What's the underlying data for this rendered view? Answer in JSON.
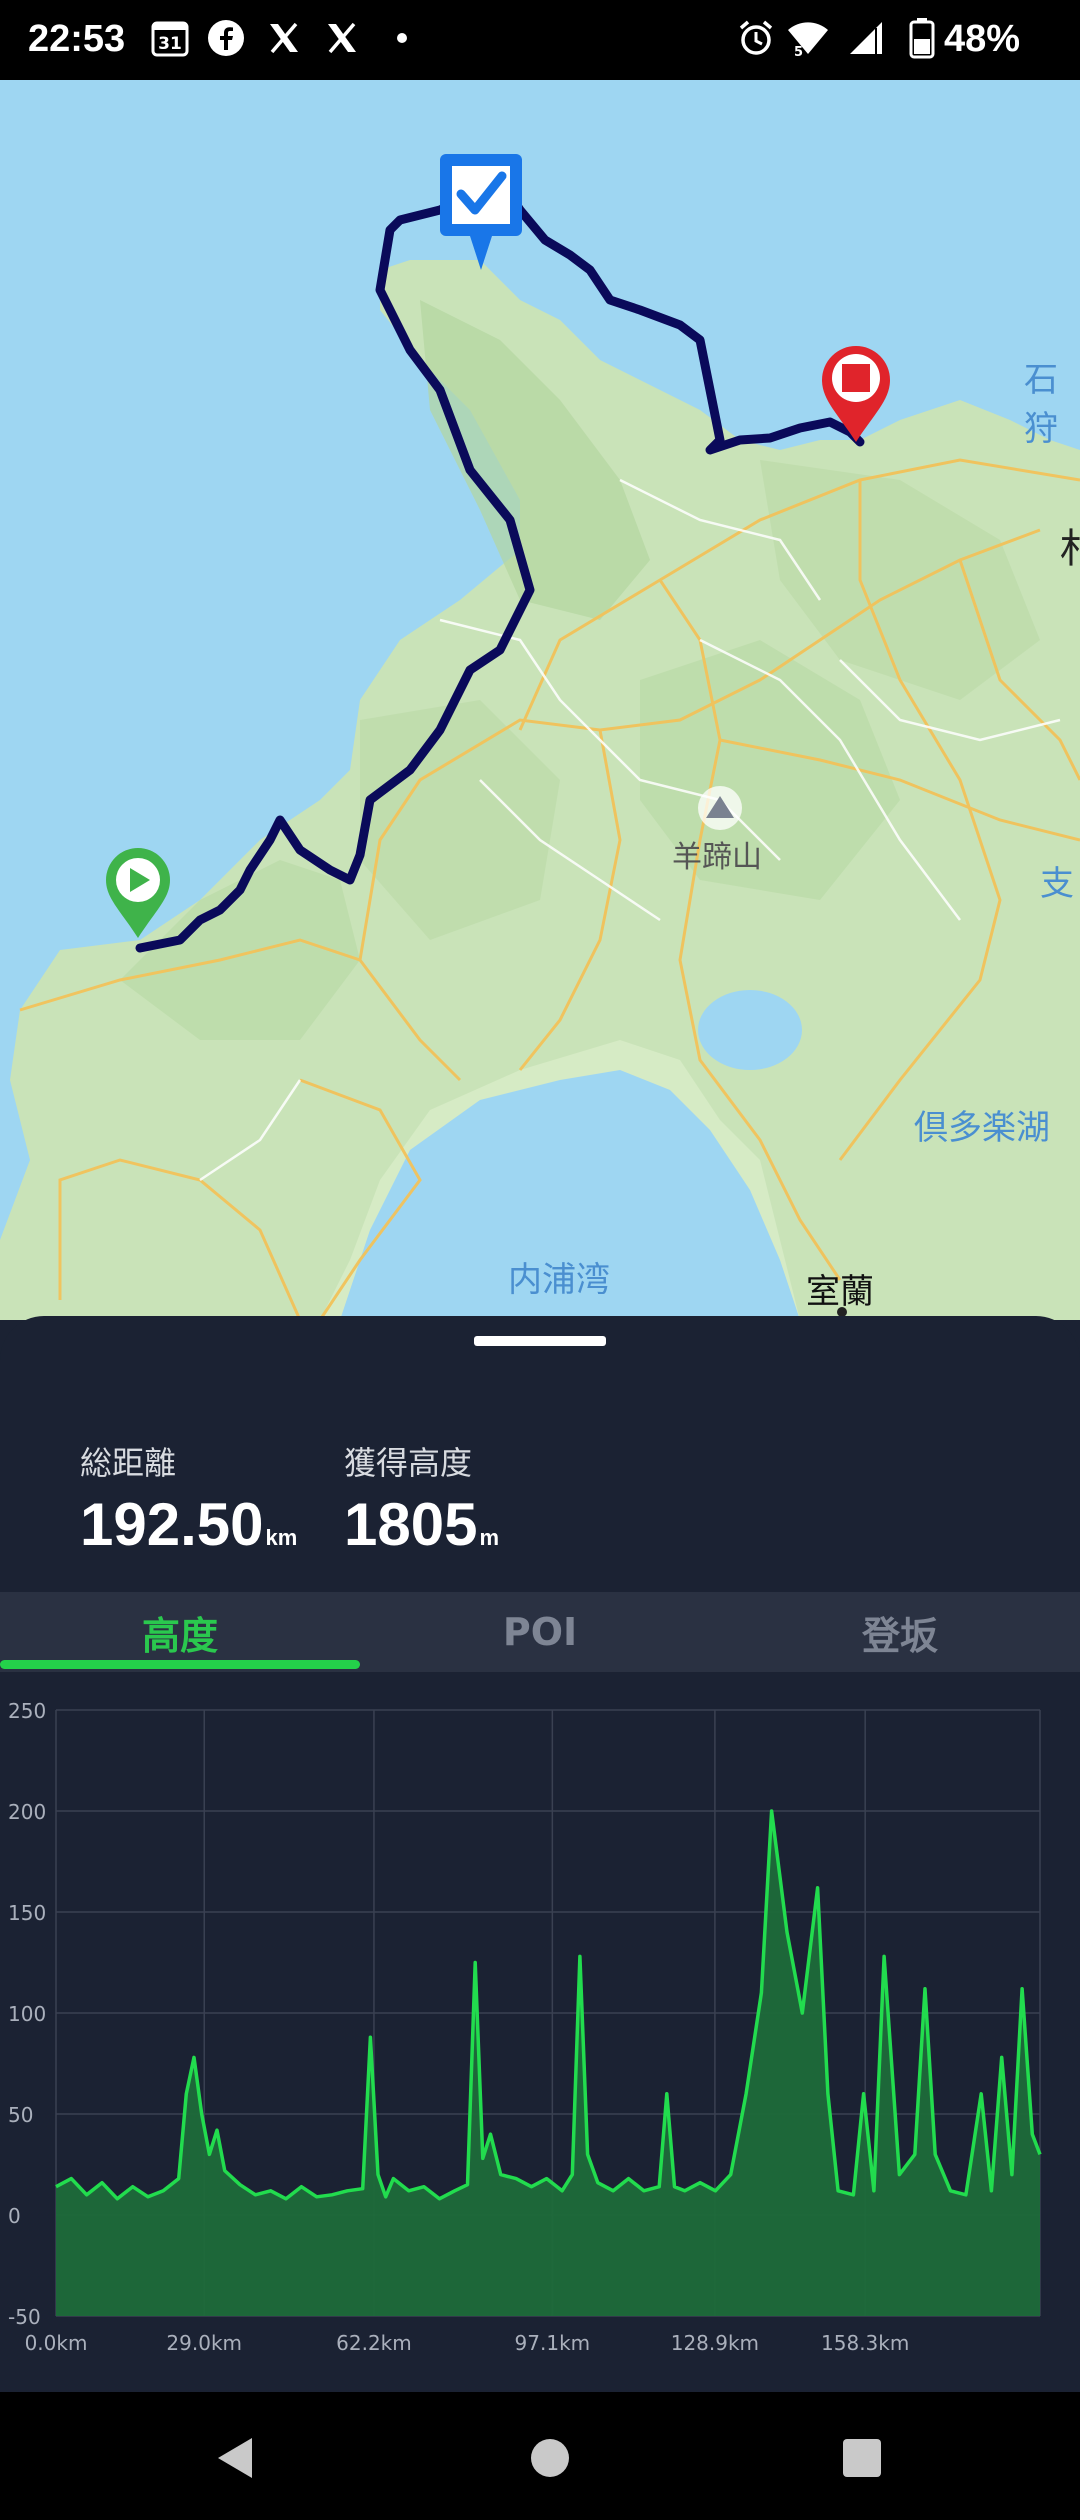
{
  "status_bar": {
    "time": "22:53",
    "calendar_day": "31",
    "battery": "48%",
    "icons": [
      "calendar-icon",
      "facebook-icon",
      "x-icon",
      "x-icon",
      "dot-icon",
      "alarm-icon",
      "wifi-icon",
      "signal-icon",
      "battery-icon"
    ]
  },
  "map": {
    "labels": {
      "ishikari": "石狩",
      "sa": "札",
      "shi": "支",
      "yotei": "羊蹄山",
      "kuttara": "倶多楽湖",
      "uchiura": "内浦湾",
      "muroran": "室蘭"
    },
    "colors": {
      "route": "#0a0a5a",
      "start": "#3fb34a",
      "checkpoint": "#1976e8",
      "finish": "#e0242b",
      "sea": "#9ed6f2",
      "land": "#c9e3b8"
    }
  },
  "stats": {
    "distance_label": "総距離",
    "distance_value": "192.50",
    "distance_unit": "km",
    "elevation_label": "獲得高度",
    "elevation_value": "1805",
    "elevation_unit": "m"
  },
  "tabs": [
    {
      "label": "高度",
      "active": true
    },
    {
      "label": "POI",
      "active": false
    },
    {
      "label": "登坂",
      "active": false
    }
  ],
  "chart_data": {
    "type": "area",
    "ylim": [
      -50,
      250
    ],
    "yticks": [
      "250",
      "200",
      "150",
      "100",
      "50",
      "0",
      "-50"
    ],
    "xticks": [
      "0.0km",
      "29.0km",
      "62.2km",
      "97.1km",
      "128.9km",
      "158.3km"
    ],
    "xlim": [
      0,
      192.5
    ],
    "x": [
      0,
      3,
      6,
      9,
      12,
      15,
      18,
      21,
      24,
      25.5,
      27,
      28.5,
      30,
      31.5,
      33,
      36,
      39,
      42,
      45,
      48,
      51,
      54,
      57,
      60,
      61.5,
      63,
      64.5,
      66,
      69,
      72,
      75,
      78,
      80.5,
      82,
      83.5,
      85,
      87,
      90,
      93,
      96,
      99,
      101,
      102.5,
      104,
      106,
      109,
      112,
      115,
      118,
      119.5,
      121,
      123,
      126,
      129,
      132,
      135,
      138,
      140,
      143,
      146,
      149,
      151,
      153,
      156,
      158,
      160,
      162,
      165,
      168,
      170,
      172,
      175,
      178,
      181,
      183,
      185,
      187,
      189,
      191,
      192.5
    ],
    "values": [
      14,
      18,
      10,
      16,
      8,
      14,
      9,
      12,
      18,
      60,
      78,
      50,
      30,
      42,
      22,
      15,
      10,
      12,
      8,
      14,
      9,
      10,
      12,
      13,
      88,
      20,
      9,
      18,
      12,
      14,
      8,
      12,
      15,
      125,
      28,
      40,
      20,
      18,
      14,
      18,
      12,
      20,
      128,
      30,
      16,
      12,
      18,
      12,
      14,
      60,
      14,
      12,
      16,
      12,
      20,
      60,
      110,
      200,
      140,
      100,
      162,
      60,
      12,
      10,
      60,
      12,
      128,
      20,
      30,
      112,
      30,
      12,
      10,
      60,
      12,
      78,
      20,
      112,
      40,
      30
    ]
  },
  "nav_icons": [
    "back-icon",
    "home-icon",
    "recents-icon"
  ]
}
